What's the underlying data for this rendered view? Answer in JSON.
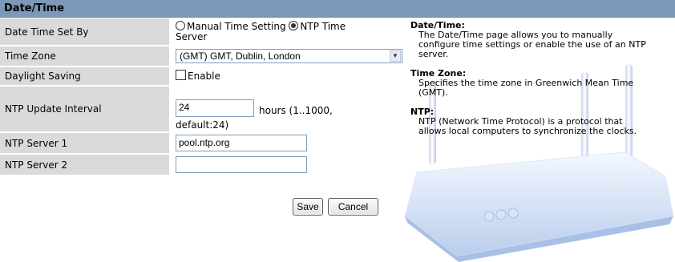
{
  "header": {
    "title": "Date/Time"
  },
  "form": {
    "date_time_set_by": {
      "label": "Date Time Set By",
      "option_manual": "Manual Time Setting",
      "option_ntp_line1": "NTP Time",
      "option_ntp_line2": "Server",
      "selected": "NTP Time Server"
    },
    "time_zone": {
      "label": "Time Zone",
      "value": "(GMT) GMT, Dublin, London"
    },
    "daylight_saving": {
      "label": "Daylight Saving",
      "checkbox_label": "Enable",
      "checked": false
    },
    "ntp_update_interval": {
      "label": "NTP Update Interval",
      "value": "24",
      "hint_line1": "hours (1..1000,",
      "hint_line2": "default:24)"
    },
    "ntp_server_1": {
      "label": "NTP Server 1",
      "value": "pool.ntp.org"
    },
    "ntp_server_2": {
      "label": "NTP Server 2",
      "value": ""
    }
  },
  "buttons": {
    "save": "Save",
    "cancel": "Cancel"
  },
  "help": {
    "date_time": {
      "heading": "Date/Time:",
      "lines": [
        "The Date/Time page allows you to manually",
        "configure time settings or enable the use of an NTP",
        "server."
      ]
    },
    "time_zone": {
      "heading": "Time Zone:",
      "lines": [
        "Specifies the time zone in Greenwich Mean Time",
        "(GMT)."
      ]
    },
    "ntp": {
      "heading": "NTP:",
      "lines": [
        "NTP (Network Time Protocol) is a protocol that",
        "allows local computers to synchronize the clocks."
      ]
    }
  },
  "colors": {
    "header_bg": "#7d98b8",
    "label_bg": "#dadada"
  },
  "icons": {
    "select_arrow": "chevron-down-icon",
    "router_image": "router-illustration"
  }
}
